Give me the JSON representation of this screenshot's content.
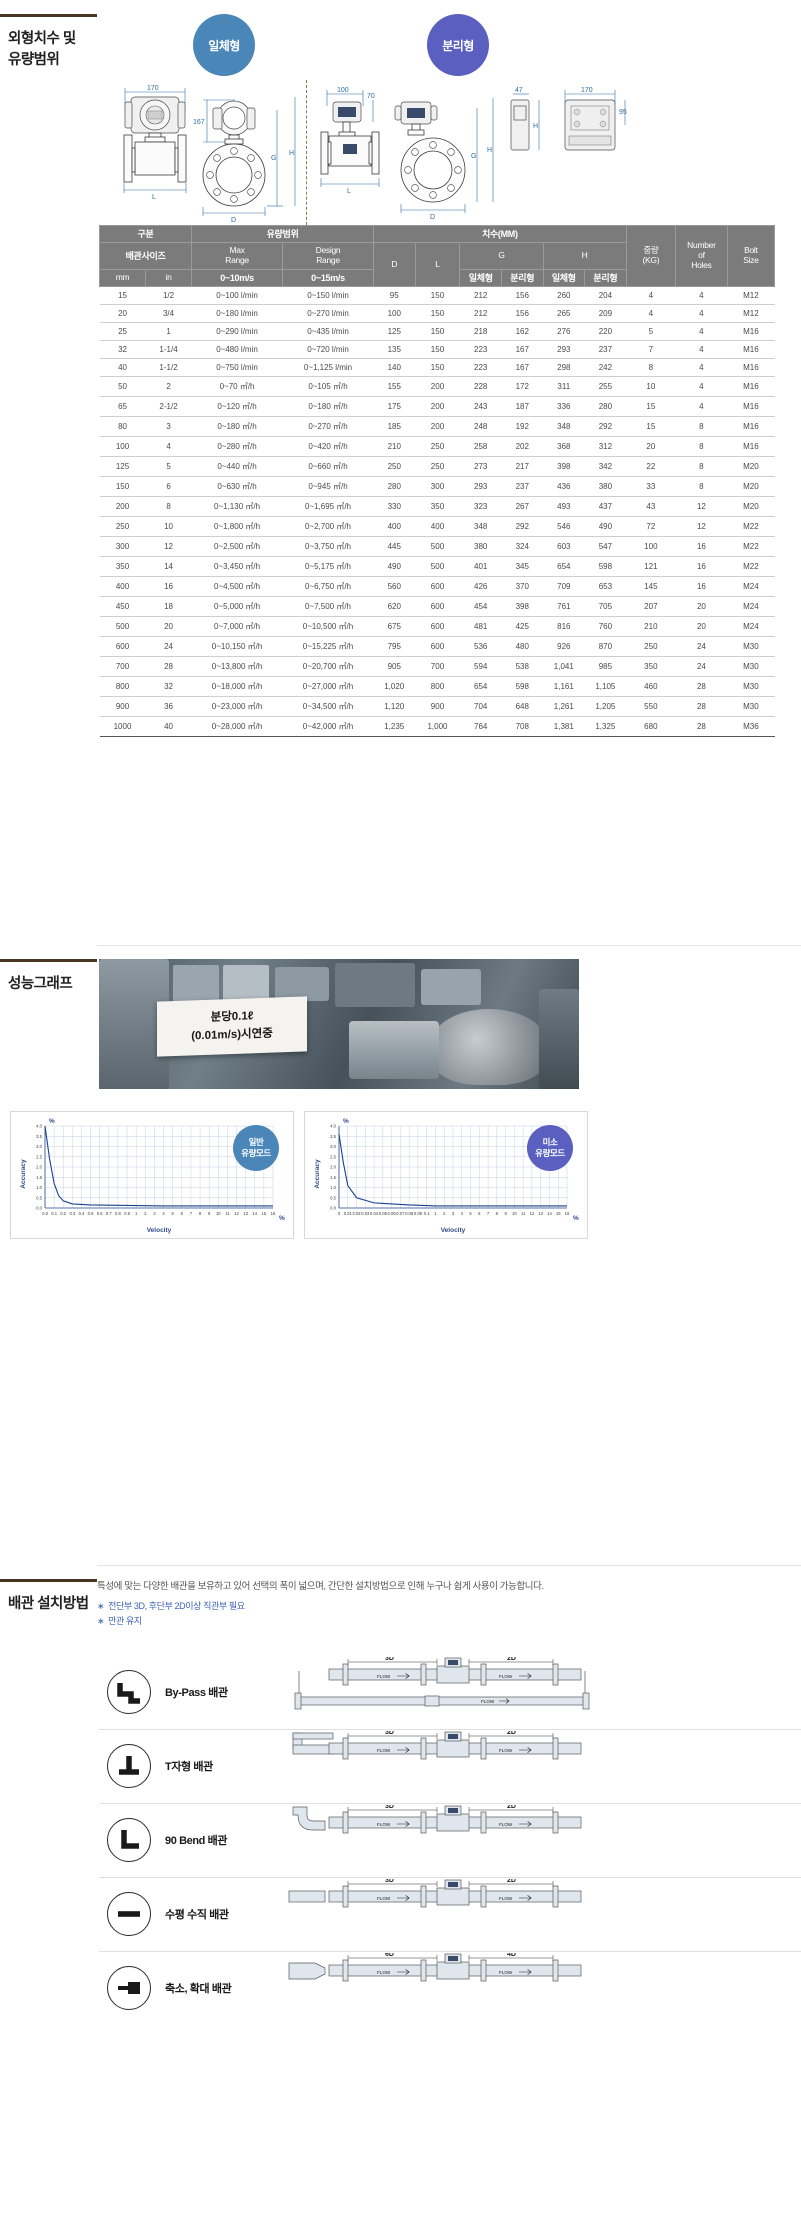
{
  "sections": {
    "dimensions": {
      "title": "외형치수 및\n유량범위",
      "title_line1": "외형치수 및",
      "title_line2": "유량범위",
      "badges": [
        {
          "label": "일체형",
          "color": "#4a86b8"
        },
        {
          "label": "분리형",
          "color": "#5a5fc0"
        }
      ],
      "drawing_dims": {
        "integral_width": "170",
        "integral_height": "167",
        "separate_width": "100",
        "separate_height": "70",
        "converter_depth": "47",
        "converter_width": "170",
        "converter_height": "95",
        "letter_G": "G",
        "letter_H": "H",
        "letter_L": "L",
        "letter_D": "D"
      }
    },
    "table": {
      "header": {
        "group_division": "구분",
        "group_flow_range": "유량범위",
        "group_dimensions": "치수(MM)",
        "pipe_size": "배관사이즈",
        "max_range": "Max\nRange",
        "max_range_l1": "Max",
        "max_range_l2": "Range",
        "design_range_l1": "Design",
        "design_range_l2": "Range",
        "col_D": "D",
        "col_L": "L",
        "col_G": "G",
        "col_H": "H",
        "weight_l1": "중량",
        "weight_l2": "(KG)",
        "holes_l1": "Number",
        "holes_l2": "of",
        "holes_l3": "Holes",
        "bolt_l1": "Bolt",
        "bolt_l2": "Size",
        "unit_mm": "mm",
        "unit_in": "in",
        "speed_max": "0~10m/s",
        "speed_design": "0~15m/s",
        "type_integral": "일체형",
        "type_separate": "분리형"
      },
      "rows": [
        [
          "15",
          "1/2",
          "0~100 l/min",
          "0~150 l/min",
          "95",
          "150",
          "212",
          "156",
          "260",
          "204",
          "4",
          "4",
          "M12"
        ],
        [
          "20",
          "3/4",
          "0~180 l/min",
          "0~270 l/min",
          "100",
          "150",
          "212",
          "156",
          "265",
          "209",
          "4",
          "4",
          "M12"
        ],
        [
          "25",
          "1",
          "0~290 l/min",
          "0~435 l/min",
          "125",
          "150",
          "218",
          "162",
          "276",
          "220",
          "5",
          "4",
          "M16"
        ],
        [
          "32",
          "1-1/4",
          "0~480 l/min",
          "0~720 l/min",
          "135",
          "150",
          "223",
          "167",
          "293",
          "237",
          "7",
          "4",
          "M16"
        ],
        [
          "40",
          "1-1/2",
          "0~750 l/min",
          "0~1,125 l/min",
          "140",
          "150",
          "223",
          "167",
          "298",
          "242",
          "8",
          "4",
          "M16"
        ],
        [
          "50",
          "2",
          "0~70 ㎥/h",
          "0~105 ㎥/h",
          "155",
          "200",
          "228",
          "172",
          "311",
          "255",
          "10",
          "4",
          "M16"
        ],
        [
          "65",
          "2-1/2",
          "0~120 ㎥/h",
          "0~180 ㎥/h",
          "175",
          "200",
          "243",
          "187",
          "336",
          "280",
          "15",
          "4",
          "M16"
        ],
        [
          "80",
          "3",
          "0~180 ㎥/h",
          "0~270 ㎥/h",
          "185",
          "200",
          "248",
          "192",
          "348",
          "292",
          "15",
          "8",
          "M16"
        ],
        [
          "100",
          "4",
          "0~280 ㎥/h",
          "0~420 ㎥/h",
          "210",
          "250",
          "258",
          "202",
          "368",
          "312",
          "20",
          "8",
          "M16"
        ],
        [
          "125",
          "5",
          "0~440 ㎥/h",
          "0~660 ㎥/h",
          "250",
          "250",
          "273",
          "217",
          "398",
          "342",
          "22",
          "8",
          "M20"
        ],
        [
          "150",
          "6",
          "0~630 ㎥/h",
          "0~945 ㎥/h",
          "280",
          "300",
          "293",
          "237",
          "436",
          "380",
          "33",
          "8",
          "M20"
        ],
        [
          "200",
          "8",
          "0~1,130 ㎥/h",
          "0~1,695 ㎥/h",
          "330",
          "350",
          "323",
          "267",
          "493",
          "437",
          "43",
          "12",
          "M20"
        ],
        [
          "250",
          "10",
          "0~1,800 ㎥/h",
          "0~2,700 ㎥/h",
          "400",
          "400",
          "348",
          "292",
          "546",
          "490",
          "72",
          "12",
          "M22"
        ],
        [
          "300",
          "12",
          "0~2,500 ㎥/h",
          "0~3,750 ㎥/h",
          "445",
          "500",
          "380",
          "324",
          "603",
          "547",
          "100",
          "16",
          "M22"
        ],
        [
          "350",
          "14",
          "0~3,450 ㎥/h",
          "0~5,175 ㎥/h",
          "490",
          "500",
          "401",
          "345",
          "654",
          "598",
          "121",
          "16",
          "M22"
        ],
        [
          "400",
          "16",
          "0~4,500 ㎥/h",
          "0~6,750 ㎥/h",
          "560",
          "600",
          "426",
          "370",
          "709",
          "653",
          "145",
          "16",
          "M24"
        ],
        [
          "450",
          "18",
          "0~5,000 ㎥/h",
          "0~7,500 ㎥/h",
          "620",
          "600",
          "454",
          "398",
          "761",
          "705",
          "207",
          "20",
          "M24"
        ],
        [
          "500",
          "20",
          "0~7,000 ㎥/h",
          "0~10,500 ㎥/h",
          "675",
          "600",
          "481",
          "425",
          "816",
          "760",
          "210",
          "20",
          "M24"
        ],
        [
          "600",
          "24",
          "0~10,150 ㎥/h",
          "0~15,225 ㎥/h",
          "795",
          "600",
          "536",
          "480",
          "926",
          "870",
          "250",
          "24",
          "M30"
        ],
        [
          "700",
          "28",
          "0~13,800 ㎥/h",
          "0~20,700 ㎥/h",
          "905",
          "700",
          "594",
          "538",
          "1,041",
          "985",
          "350",
          "24",
          "M30"
        ],
        [
          "800",
          "32",
          "0~18,000 ㎥/h",
          "0~27,000 ㎥/h",
          "1,020",
          "800",
          "654",
          "598",
          "1,161",
          "1,105",
          "460",
          "28",
          "M30"
        ],
        [
          "900",
          "36",
          "0~23,000 ㎥/h",
          "0~34,500 ㎥/h",
          "1,120",
          "900",
          "704",
          "648",
          "1,261",
          "1,205",
          "550",
          "28",
          "M30"
        ],
        [
          "1000",
          "40",
          "0~28,000 ㎥/h",
          "0~42,000 ㎥/h",
          "1,235",
          "1,000",
          "764",
          "708",
          "1,381",
          "1,325",
          "680",
          "28",
          "M36"
        ]
      ]
    },
    "graph": {
      "title": "성능그래프",
      "photo_sign_line1": "분당0.1ℓ",
      "photo_sign_line2": "(0.01m/s)시연중",
      "charts": [
        {
          "badge_l1": "일반",
          "badge_l2": "유량모드",
          "badge_color": "#4a86b8",
          "xlabel": "Velocity",
          "ylabel": "Accuracy",
          "yunit": "%",
          "xunit": "%"
        },
        {
          "badge_l1": "미소",
          "badge_l2": "유량모드",
          "badge_color": "#5a5fc0",
          "xlabel": "Velocity",
          "ylabel": "Accuracy",
          "yunit": "%",
          "xunit": "%"
        }
      ]
    },
    "piping": {
      "title": "배관 설치방법",
      "intro": "특성에 맞는 다양한 배관을 보유하고 있어 선택의 폭이 넓으며, 간단한 설치방법으로 인해 누구나 쉽게 사용이 가능합니다.",
      "bullets": [
        "전단부 3D, 후단부 2D이상 직관부 필요",
        "만관 유지"
      ],
      "rows": [
        {
          "label": "By-Pass 배관",
          "icon": "bypass-icon",
          "up": "3D",
          "down": "2D",
          "flow": "FLOW"
        },
        {
          "label": "T자형 배관",
          "icon": "tee-icon",
          "up": "3D",
          "down": "2D",
          "flow": "FLOW"
        },
        {
          "label": "90 Bend 배관",
          "icon": "elbow-icon",
          "up": "3D",
          "down": "2D",
          "flow": "FLOW"
        },
        {
          "label": "수평 수직 배관",
          "icon": "straight-icon",
          "up": "3D",
          "down": "2D",
          "flow": "FLOW"
        },
        {
          "label": "축소, 확대 배관",
          "icon": "reducer-icon",
          "up": "6D",
          "down": "4D",
          "flow": "FLOW"
        }
      ]
    }
  },
  "chart_data": [
    {
      "type": "line",
      "title": "일반 유량모드",
      "xlabel": "Velocity",
      "ylabel": "Accuracy",
      "xunit": "%",
      "yunit": "%",
      "ylim": [
        0,
        4.0
      ],
      "yticks": [
        "4.0",
        "3.5",
        "3.0",
        "2.5",
        "2.0",
        "1.5",
        "1.0",
        "0.5",
        "0.0"
      ],
      "xlim": [
        0,
        16
      ],
      "xticks": [
        "0.0",
        "0.1",
        "0.2",
        "0.3",
        "0.4",
        "0.5",
        "0.6",
        "0.7",
        "0.8",
        "0.9",
        "1",
        "2",
        "3",
        "4",
        "5",
        "6",
        "7",
        "8",
        "9",
        "10",
        "11",
        "12",
        "13",
        "14",
        "15",
        "16"
      ],
      "series": [
        {
          "name": "Accuracy",
          "x": [
            0.0,
            0.05,
            0.1,
            0.15,
            0.2,
            0.3,
            0.5,
            1,
            4,
            8,
            12,
            16
          ],
          "y": [
            4.0,
            2.4,
            1.2,
            0.6,
            0.35,
            0.2,
            0.15,
            0.12,
            0.1,
            0.1,
            0.1,
            0.1
          ]
        }
      ],
      "grid": true,
      "legend": "none"
    },
    {
      "type": "line",
      "title": "미소 유량모드",
      "xlabel": "Velocity",
      "ylabel": "Accuracy",
      "xunit": "%",
      "yunit": "%",
      "ylim": [
        0,
        4.0
      ],
      "yticks": [
        "4.0",
        "3.5",
        "3.0",
        "2.5",
        "2.0",
        "1.5",
        "1.0",
        "0.5",
        "0.0"
      ],
      "xlim": [
        0,
        16
      ],
      "xticks": [
        "0",
        "0.01",
        "0.02",
        "0.03",
        "0.04",
        "0.05",
        "0.06",
        "0.07",
        "0.08",
        "0.09",
        "0.1",
        "1",
        "2",
        "3",
        "4",
        "5",
        "6",
        "7",
        "8",
        "9",
        "10",
        "11",
        "12",
        "13",
        "14",
        "15",
        "16"
      ],
      "series": [
        {
          "name": "Accuracy",
          "x": [
            0.0,
            0.005,
            0.01,
            0.02,
            0.04,
            0.08,
            0.1,
            1,
            6,
            11,
            16
          ],
          "y": [
            3.6,
            2.2,
            1.1,
            0.5,
            0.25,
            0.15,
            0.12,
            0.1,
            0.1,
            0.1,
            0.1
          ]
        }
      ],
      "grid": true,
      "legend": "none"
    }
  ]
}
